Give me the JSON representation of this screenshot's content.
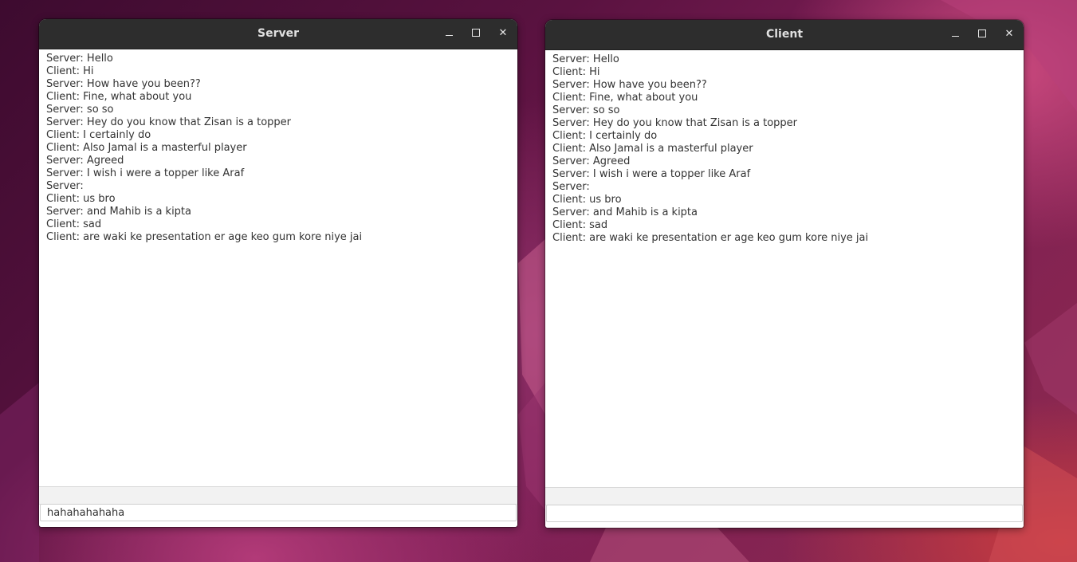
{
  "windows": {
    "server": {
      "title": "Server",
      "messages": [
        "Server: Hello",
        "Client: Hi",
        "Server: How have you been??",
        "Client: Fine, what about you",
        "Server: so so",
        "Server: Hey do you know that Zisan is a topper",
        "Client: I certainly do",
        "Client: Also Jamal is a masterful player",
        "Server: Agreed",
        "Server: I wish i were a topper like Araf",
        "Server: ",
        "Client: us bro",
        "Server: and Mahib is a kipta",
        "Client: sad",
        "Client: are waki ke presentation er age keo gum kore niye jai"
      ],
      "input_value": "hahahahahaha"
    },
    "client": {
      "title": "Client",
      "messages": [
        "Server: Hello",
        "Client: Hi",
        "Server: How have you been??",
        "Client: Fine, what about you",
        "Server: so so",
        "Server: Hey do you know that Zisan is a topper",
        "Client: I certainly do",
        "Client: Also Jamal is a masterful player",
        "Server: Agreed",
        "Server: I wish i were a topper like Araf",
        "Server: ",
        "Client: us bro",
        "Server: and Mahib is a kipta",
        "Client: sad",
        "Client: are waki ke presentation er age keo gum kore niye jai"
      ],
      "input_value": ""
    }
  },
  "titlebar_icons": [
    "minimize-icon",
    "maximize-icon",
    "close-icon"
  ],
  "colors": {
    "titlebar": "#2d2d2d",
    "title_text": "#e0e0e0",
    "chat_text": "#333333",
    "status_bar": "#f2f2f2",
    "desktop_dark": "#3d0b2f",
    "desktop_accent": "#c9487d"
  }
}
